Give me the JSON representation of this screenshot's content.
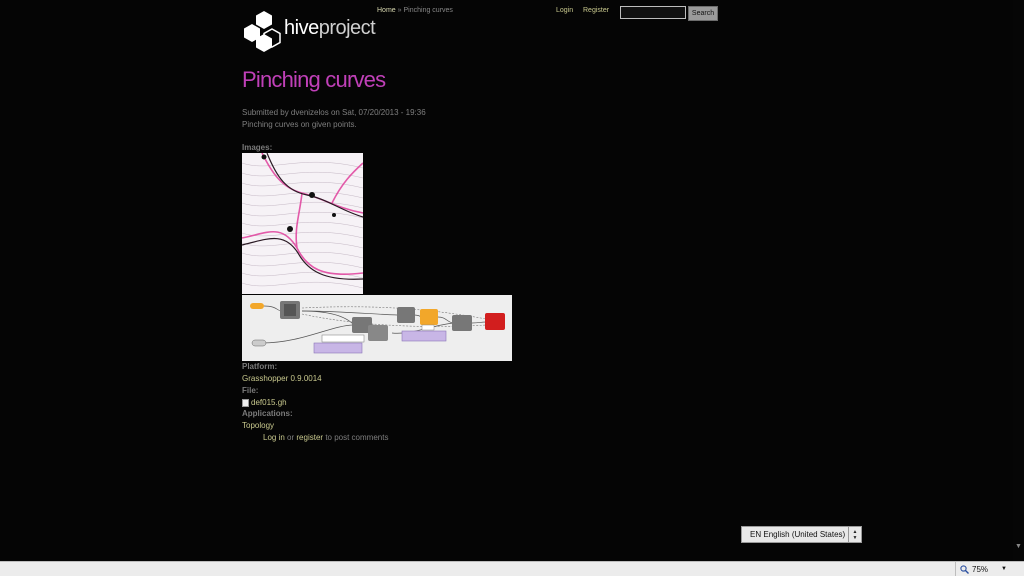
{
  "header": {
    "breadcrumb": {
      "home": "Home",
      "sep": "»",
      "current": "Pinching curves"
    },
    "logo": {
      "bold": "hive",
      "thin": "project"
    },
    "login": "Login",
    "register": "Register",
    "search": {
      "value": "",
      "button": "Search"
    }
  },
  "node": {
    "title": "Pinching curves",
    "submitted": "Submitted by dvenizelos on Sat, 07/20/2013 - 19:36",
    "description": "Pinching curves on given points.",
    "images_label": "Images:",
    "platform_label": "Platform:",
    "platform_value": "Grasshopper 0.9.0014",
    "file_label": "File:",
    "file_name": "def015.gh",
    "applications_label": "Applications:",
    "applications_value": "Topology",
    "comments": {
      "login": "Log in",
      "or": "or",
      "register": "register",
      "tail": "to post comments"
    }
  },
  "language": {
    "code": "EN",
    "name": "English (United States)"
  },
  "statusbar": {
    "zoom": "75%"
  },
  "colors": {
    "title": "#c040b8",
    "link": "#c9c98e",
    "background": "#050505"
  }
}
